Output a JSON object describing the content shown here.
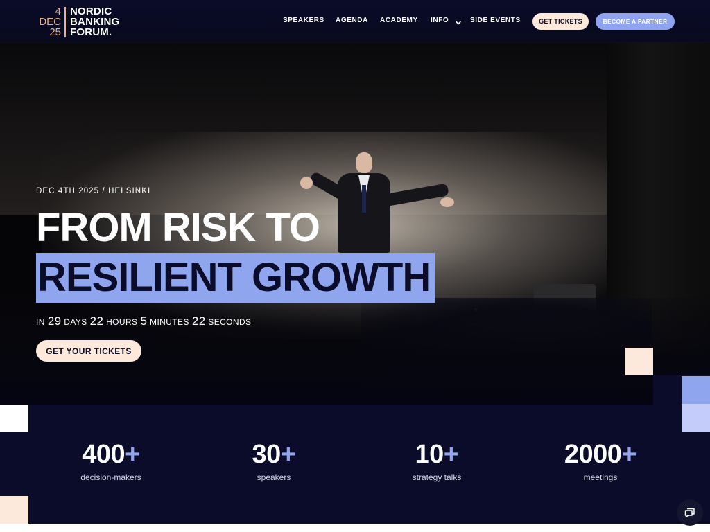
{
  "logo": {
    "date_lines": [
      "4",
      "DEC",
      "25"
    ],
    "name_lines": [
      "NORDIC",
      "BANKING",
      "FORUM."
    ]
  },
  "nav": {
    "items": [
      "SPEAKERS",
      "AGENDA",
      "ACADEMY",
      "INFO",
      "SIDE EVENTS"
    ],
    "info_chevron_icon": "chevron-down-icon",
    "get_tickets": "GET TICKETS",
    "become_partner": "BECOME A PARTNER"
  },
  "hero": {
    "eyebrow": "DEC 4TH 2025 / HELSINKI",
    "headline_line1": "FROM RISK TO",
    "headline_line2": "RESILIENT GROWTH",
    "countdown": {
      "prefix": "IN",
      "days": "29",
      "days_label": "DAYS",
      "hours": "22",
      "hours_label": "HOURS",
      "minutes": "5",
      "minutes_label": "MINUTES",
      "seconds": "22",
      "seconds_label": "SECONDS"
    },
    "cta": "GET YOUR TICKETS"
  },
  "stats": [
    {
      "number": "400",
      "suffix": "+",
      "label": "decision-makers"
    },
    {
      "number": "30",
      "suffix": "+",
      "label": "speakers"
    },
    {
      "number": "10",
      "suffix": "+",
      "label": "strategy talks"
    },
    {
      "number": "2000",
      "suffix": "+",
      "label": "meetings"
    }
  ],
  "colors": {
    "navy": "#0b0b2a",
    "peach": "#fde9dc",
    "accent_blue": "#8fa6ee",
    "light_blue": "#c4cdfa",
    "logo_gold": "#e7b48e"
  },
  "chat": {
    "icon": "chat-icon"
  }
}
